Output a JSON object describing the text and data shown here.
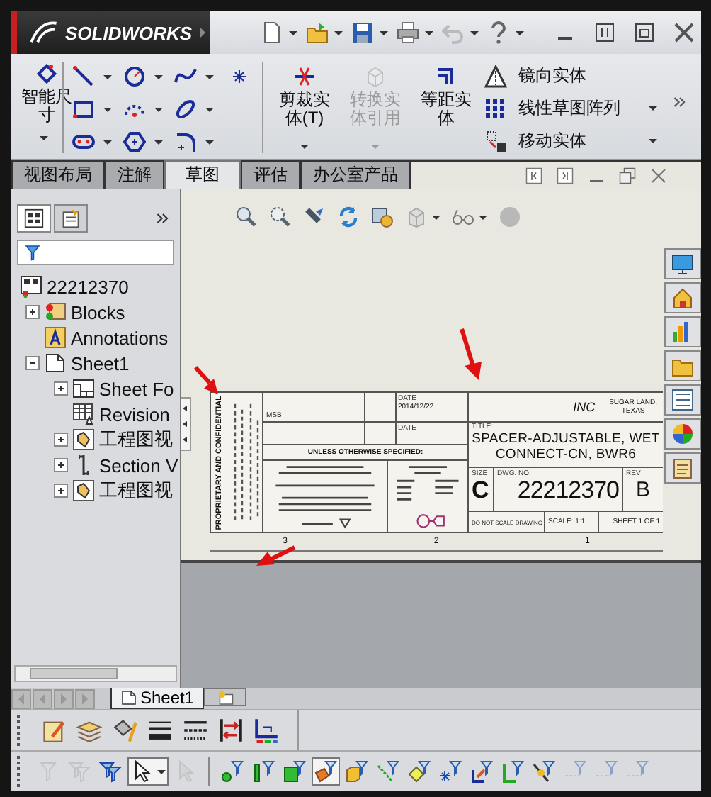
{
  "title_bar": {
    "brand": "SOLIDWORKS"
  },
  "ribbon": {
    "smart_dimension": {
      "label": "智能尺寸"
    },
    "big_buttons": [
      {
        "kind": "trim",
        "label": "剪裁实体(T)",
        "disabled": false,
        "dropdown": true
      },
      {
        "kind": "convert",
        "label": "转换实体引用",
        "disabled": true,
        "dropdown": true
      },
      {
        "kind": "offset",
        "label": "等距实体",
        "disabled": false,
        "dropdown": false
      }
    ],
    "list_buttons": [
      {
        "kind": "mirror",
        "label": "镜向实体",
        "dropdown": false
      },
      {
        "kind": "pattern",
        "label": "线性草图阵列",
        "dropdown": true
      },
      {
        "kind": "move",
        "label": "移动实体",
        "dropdown": true
      }
    ]
  },
  "tabs": [
    {
      "label": "视图布局",
      "selected": false
    },
    {
      "label": "注解",
      "selected": false
    },
    {
      "label": "草图",
      "selected": true
    },
    {
      "label": "评估",
      "selected": false
    },
    {
      "label": "办公室产品",
      "selected": false
    }
  ],
  "feature_tree": {
    "items": [
      {
        "kind": "document",
        "label": "22212370",
        "children": [
          {
            "kind": "blocks",
            "label": "Blocks",
            "expanded": false
          },
          {
            "kind": "annotations",
            "label": "Annotations"
          },
          {
            "kind": "sheet",
            "label": "Sheet1",
            "expanded": true,
            "children": [
              {
                "kind": "sheet-format",
                "label": "Sheet Fo",
                "expanded": false
              },
              {
                "kind": "revision-table",
                "label": "Revision"
              },
              {
                "kind": "drawing-view",
                "label": "工程图视",
                "expanded": false
              },
              {
                "kind": "section-view",
                "label": "Section V",
                "expanded": false
              },
              {
                "kind": "drawing-view",
                "label": "工程图视",
                "expanded": false
              }
            ]
          }
        ]
      }
    ]
  },
  "title_block": {
    "confidential": "PROPRIETARY AND CONFIDENTIAL",
    "drawn_by": "MSB",
    "date_label": "DATE",
    "date": "2014/12/22",
    "date_label_2": "DATE",
    "tolerance_note": "UNLESS OTHERWISE SPECIFIED:",
    "company": "INC",
    "location_1": "SUGAR LAND,",
    "location_2": "TEXAS",
    "title_label": "TITLE:",
    "title_1": "SPACER-ADJUSTABLE, WET",
    "title_2": "CONNECT-CN, BWR6",
    "size_label": "SIZE",
    "size": "C",
    "dwg_label": "DWG. NO.",
    "dwg_no": "22212370",
    "rev_label": "REV",
    "rev": "B",
    "no_scale": "DO NOT SCALE DRAWING",
    "scale": "SCALE: 1:1",
    "sheet": "SHEET 1 OF 1",
    "zones": [
      "3",
      "2",
      "1"
    ]
  },
  "sheet_tabs": [
    {
      "label": "Sheet1",
      "selected": true
    }
  ],
  "selection_filters": [
    {
      "pressed": false,
      "disabled": true
    },
    {
      "pressed": false,
      "disabled": true
    },
    {
      "pressed": false,
      "disabled": false
    },
    {
      "pressed": true,
      "disabled": false
    },
    {
      "pressed": false,
      "disabled": true
    },
    {
      "pressed": false,
      "disabled": false
    },
    {
      "pressed": false,
      "disabled": false
    },
    {
      "pressed": false,
      "disabled": false
    },
    {
      "pressed": true,
      "disabled": false
    },
    {
      "pressed": false,
      "disabled": false
    },
    {
      "pressed": false,
      "disabled": false
    },
    {
      "pressed": false,
      "disabled": false
    },
    {
      "pressed": false,
      "disabled": false
    },
    {
      "pressed": false,
      "disabled": false
    },
    {
      "pressed": false,
      "disabled": false
    },
    {
      "pressed": false,
      "disabled": false
    },
    {
      "pressed": false,
      "disabled": true
    },
    {
      "pressed": false,
      "disabled": true
    },
    {
      "pressed": false,
      "disabled": true
    }
  ]
}
